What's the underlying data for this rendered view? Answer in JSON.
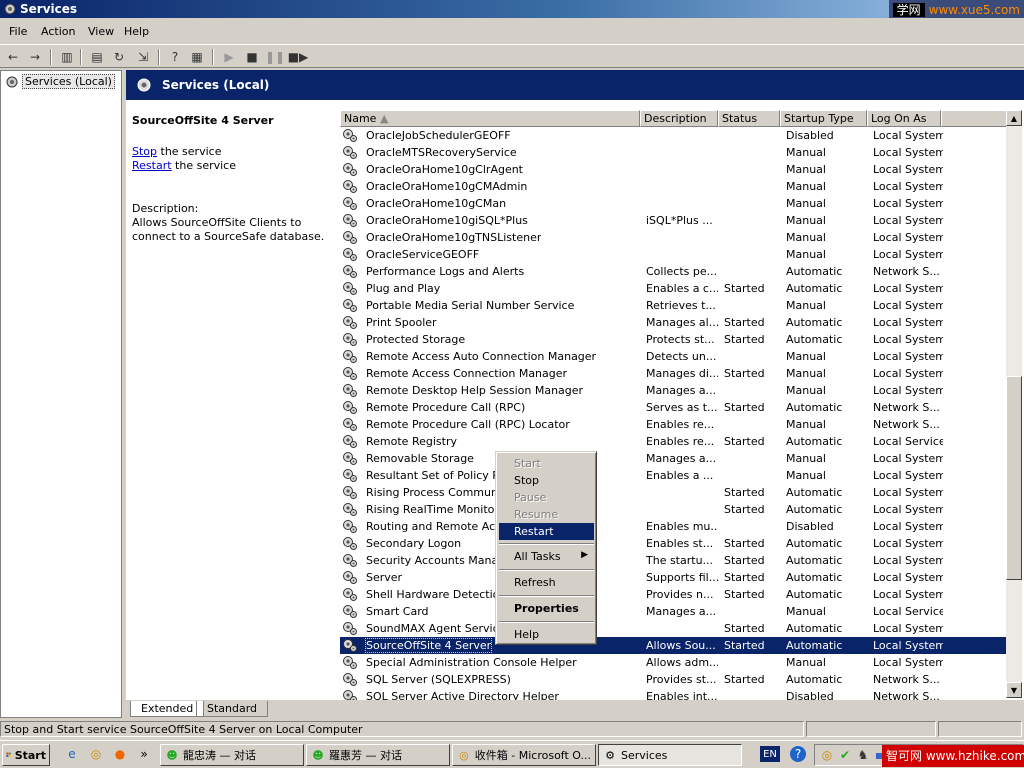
{
  "window": {
    "title": "Services",
    "watermark_cn": "学网",
    "watermark_url": "www.xue5.com"
  },
  "menu": [
    "File",
    "Action",
    "View",
    "Help"
  ],
  "tree": {
    "root_label": "Services (Local)"
  },
  "header": {
    "title": "Services (Local)"
  },
  "detail": {
    "service_name": "SourceOffSite 4 Server",
    "stop_link": "Stop",
    "stop_suffix": " the service",
    "restart_link": "Restart",
    "restart_suffix": " the service",
    "description_label": "Description:",
    "description_text": "Allows SourceOffSite Clients to connect to a SourceSafe database."
  },
  "columns": [
    "Name",
    "Description",
    "Status",
    "Startup Type",
    "Log On As"
  ],
  "rows": [
    [
      "OracleJobSchedulerGEOFF",
      "",
      "",
      "Disabled",
      "Local System"
    ],
    [
      "OracleMTSRecoveryService",
      "",
      "",
      "Manual",
      "Local System"
    ],
    [
      "OracleOraHome10gClrAgent",
      "",
      "",
      "Manual",
      "Local System"
    ],
    [
      "OracleOraHome10gCMAdmin",
      "",
      "",
      "Manual",
      "Local System"
    ],
    [
      "OracleOraHome10gCMan",
      "",
      "",
      "Manual",
      "Local System"
    ],
    [
      "OracleOraHome10giSQL*Plus",
      "iSQL*Plus ...",
      "",
      "Manual",
      "Local System"
    ],
    [
      "OracleOraHome10gTNSListener",
      "",
      "",
      "Manual",
      "Local System"
    ],
    [
      "OracleServiceGEOFF",
      "",
      "",
      "Manual",
      "Local System"
    ],
    [
      "Performance Logs and Alerts",
      "Collects pe...",
      "",
      "Automatic",
      "Network S..."
    ],
    [
      "Plug and Play",
      "Enables a c...",
      "Started",
      "Automatic",
      "Local System"
    ],
    [
      "Portable Media Serial Number Service",
      "Retrieves t...",
      "",
      "Manual",
      "Local System"
    ],
    [
      "Print Spooler",
      "Manages al...",
      "Started",
      "Automatic",
      "Local System"
    ],
    [
      "Protected Storage",
      "Protects st...",
      "Started",
      "Automatic",
      "Local System"
    ],
    [
      "Remote Access Auto Connection Manager",
      "Detects un...",
      "",
      "Manual",
      "Local System"
    ],
    [
      "Remote Access Connection Manager",
      "Manages di...",
      "Started",
      "Manual",
      "Local System"
    ],
    [
      "Remote Desktop Help Session Manager",
      "Manages a...",
      "",
      "Manual",
      "Local System"
    ],
    [
      "Remote Procedure Call (RPC)",
      "Serves as t...",
      "Started",
      "Automatic",
      "Network S..."
    ],
    [
      "Remote Procedure Call (RPC) Locator",
      "Enables re...",
      "",
      "Manual",
      "Network S..."
    ],
    [
      "Remote Registry",
      "Enables re...",
      "Started",
      "Automatic",
      "Local Service"
    ],
    [
      "Removable Storage",
      "Manages a...",
      "",
      "Manual",
      "Local System"
    ],
    [
      "Resultant Set of Policy Prov",
      "Enables a ...",
      "",
      "Manual",
      "Local System"
    ],
    [
      "Rising Process Communicatio",
      "",
      "Started",
      "Automatic",
      "Local System"
    ],
    [
      "Rising RealTime Monitor",
      "",
      "Started",
      "Automatic",
      "Local System"
    ],
    [
      "Routing and Remote Access",
      "Enables mu...",
      "",
      "Disabled",
      "Local System"
    ],
    [
      "Secondary Logon",
      "Enables st...",
      "Started",
      "Automatic",
      "Local System"
    ],
    [
      "Security Accounts Manager",
      "The startu...",
      "Started",
      "Automatic",
      "Local System"
    ],
    [
      "Server",
      "Supports fil...",
      "Started",
      "Automatic",
      "Local System"
    ],
    [
      "Shell Hardware Detection",
      "Provides n...",
      "Started",
      "Automatic",
      "Local System"
    ],
    [
      "Smart Card",
      "Manages a...",
      "",
      "Manual",
      "Local Service"
    ],
    [
      "SoundMAX Agent Service",
      "",
      "Started",
      "Automatic",
      "Local System"
    ],
    [
      "SourceOffSite 4 Server",
      "Allows Sou...",
      "Started",
      "Automatic",
      "Local System"
    ],
    [
      "Special Administration Console Helper",
      "Allows adm...",
      "",
      "Manual",
      "Local System"
    ],
    [
      "SQL Server (SQLEXPRESS)",
      "Provides st...",
      "Started",
      "Automatic",
      "Network S..."
    ],
    [
      "SQL Server Active Directory Helper",
      "Enables int...",
      "",
      "Disabled",
      "Network S..."
    ]
  ],
  "selected_row": 30,
  "tabs": [
    "Extended",
    "Standard"
  ],
  "context_menu": {
    "start": "Start",
    "stop": "Stop",
    "pause": "Pause",
    "resume": "Resume",
    "restart": "Restart",
    "all_tasks": "All Tasks",
    "refresh": "Refresh",
    "properties": "Properties",
    "help": "Help"
  },
  "status_text": "Stop and Start service SourceOffSite 4 Server on Local Computer",
  "taskbar": {
    "start": "Start",
    "chevron": "»",
    "buttons": [
      "龍忠涛 — 对话",
      "羅惠芳 — 对话",
      "收件箱 - Microsoft O...",
      "Services"
    ],
    "lang": "EN",
    "watermark_cn": "智可网",
    "watermark_url": "www.hzhike.com"
  },
  "colors": {
    "title_blue": "#0a246a",
    "selection": "#0a246a",
    "face": "#d4d0c8",
    "link": "#0000cc"
  },
  "icons": [
    "back-icon",
    "forward-icon",
    "gear-icon",
    "help-icon",
    "play-icon",
    "stop-icon",
    "pause-icon",
    "restart-icon"
  ]
}
